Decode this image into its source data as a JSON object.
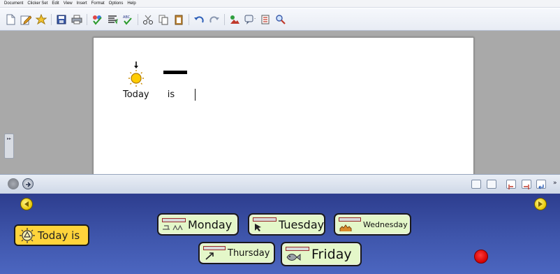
{
  "menu": [
    "Document",
    "Clicker Set",
    "Edit",
    "View",
    "Insert",
    "Format",
    "Options",
    "Help"
  ],
  "toolbar": {
    "icons": [
      "new-document-icon",
      "edit-icon",
      "star-icon",
      "save-icon",
      "print-icon",
      "spellcheck-icon",
      "align-icon",
      "abc-check-icon",
      "cut-icon",
      "copy-icon",
      "paste-icon",
      "undo-icon",
      "redo-icon",
      "picture-icon",
      "speech-icon",
      "list-icon",
      "search-icon"
    ]
  },
  "document": {
    "words": [
      {
        "text": "Today",
        "symbol": "sun-icon"
      },
      {
        "text": "is",
        "symbol": "dash-icon"
      }
    ]
  },
  "side_handle": {
    "label": "▸▸"
  },
  "grid": {
    "today_cell": "Today is",
    "cells": [
      {
        "label": "Monday",
        "symbol": "monday-symbol"
      },
      {
        "label": "Tuesday",
        "symbol": "tuesday-symbol"
      },
      {
        "label": "Wednesday",
        "symbol": "wednesday-symbol"
      },
      {
        "label": "Thursday",
        "symbol": "thursday-symbol"
      },
      {
        "label": "Friday",
        "symbol": "friday-symbol"
      }
    ]
  },
  "colors": {
    "grid_background": "#3f56ac",
    "cell_fill": "#e4f7c9",
    "today_cell_fill": "#ffd43b",
    "workspace": "#a9a9a9",
    "red_button": "#d40000"
  }
}
